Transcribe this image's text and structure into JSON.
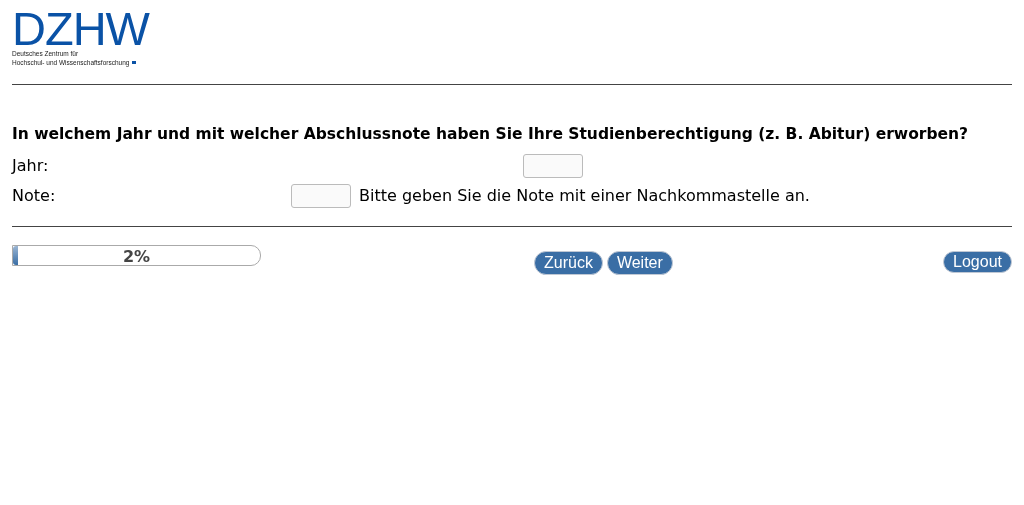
{
  "logo": {
    "wordmark": "DZHW",
    "line_1": "Deutsches Zentrum für",
    "line_2": "Hochschul- und Wissenschaftsforschung"
  },
  "question": {
    "text": "In welchem Jahr und mit welcher Abschlussnote haben Sie Ihre Studienberechtigung (z. B. Abitur) erworben?",
    "fields": [
      {
        "label": "Jahr:",
        "kind": "year"
      },
      {
        "label": "Note:",
        "kind": "grade",
        "hint": "Bitte geben Sie die Note mit einer Nachkommastelle an."
      }
    ]
  },
  "progress": {
    "level": 0.02,
    "reading": "2%"
  },
  "buttons": [
    {
      "label": "Zurück"
    },
    {
      "label": "Weiter"
    }
  ],
  "logout": {
    "label": "Logout"
  }
}
